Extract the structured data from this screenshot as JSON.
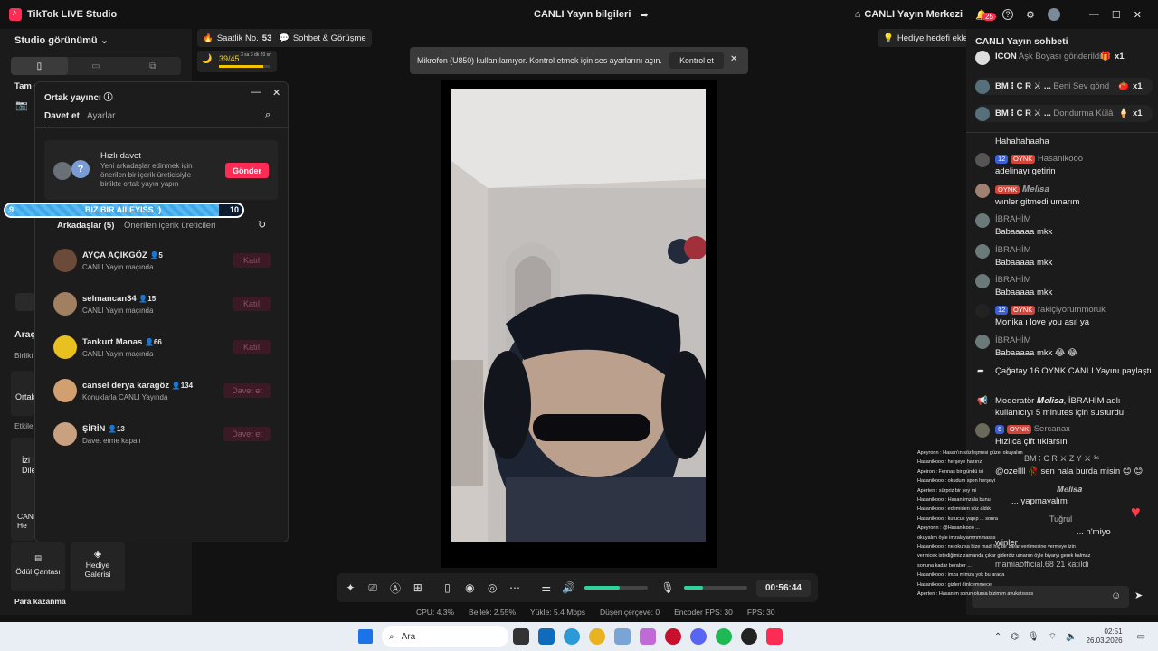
{
  "window": {
    "app_title": "TikTok LIVE Studio",
    "center_title": "CANLI Yayın bilgileri",
    "live_center": "CANLI Yayın Merkezi",
    "notif_count": "25"
  },
  "left": {
    "studio_view": "Studio görünümü",
    "tam_ekran": "Tam e",
    "araclar": "Araç",
    "birlikte": "Birlikt",
    "ortak": "Ortak",
    "etkile": "Etkile",
    "izin": "İzi",
    "dile": "Dile",
    "canli": "CANL",
    "he": "He",
    "odul": "Ödül Çantası",
    "hediye": "Hediye Galerisi",
    "para": "Para kazanma"
  },
  "stats": {
    "rank_label": "Saatlik No.",
    "rank_value": "53",
    "sohbet": "Sohbet & Görüşme",
    "progress": "39/45",
    "progress_fraction": 0.87,
    "progress_time": "3 sa 3 dk 20 sn",
    "gift_goal": "Hediye hedefi ekle"
  },
  "cohost": {
    "title": "Ortak yayıncı",
    "tab_invite": "Davet et",
    "tab_settings": "Ayarlar",
    "quick_title": "Hızlı davet",
    "quick_desc": "Yeni arkadaşlar edinmek için önerilen bir içerik üreticisiyle birlikte ortak yayın yapın",
    "send": "Gönder",
    "friends_tab": "Arkadaşlar (5)",
    "suggested_tab": "Önerilen içerik üreticileri",
    "users": [
      {
        "name": "AYÇA AÇIKGÖZ",
        "count": "5",
        "status": "CANLI Yayın maçında",
        "btn": "Katıl",
        "color": "#6b4a3a"
      },
      {
        "name": "selmancan34",
        "count": "15",
        "status": "CANLI Yayın maçında",
        "btn": "Katıl",
        "color": "#a08060"
      },
      {
        "name": "Tankurt Manas",
        "count": "66",
        "status": "CANLI Yayın maçında",
        "btn": "Katıl",
        "color": "#e8c020"
      },
      {
        "name": "cansel derya karagöz",
        "count": "134",
        "status": "Konuklarla CANLI Yayında",
        "btn": "Davet et",
        "color": "#d2a070"
      },
      {
        "name": "ŞİRİN",
        "count": "13",
        "status": "Davet etme kapalı",
        "btn": "Davet et",
        "color": "#c9a080"
      }
    ]
  },
  "banner": {
    "left": "9",
    "text": "BIZ BIR AILEYISS :)",
    "right": "10",
    "fraction": 0.9
  },
  "toast": {
    "text": "Mikrofon (U850) kullanılamıyor. Kontrol etmek için ses ayarlarını açın.",
    "button": "Kontrol et"
  },
  "controls": {
    "timer": "00:56:44",
    "volume_fraction": 0.55,
    "mic_fraction": 0.3
  },
  "status": {
    "cpu": "CPU: 4.3%",
    "mem": "Bellek: 2.55%",
    "upload": "Yükle: 5.4 Mbps",
    "drop": "Düşen çerçeve: 0",
    "encoder": "Encoder FPS: 30",
    "fps": "FPS: 30"
  },
  "chat": {
    "title": "CANLI Yayın sohbeti",
    "gifts": [
      {
        "user": "ICON",
        "text": "Aşk Boyası gönderildi",
        "count": "x1"
      },
      {
        "user": "BM ⁝ C R ⚔︎ ...",
        "text": "Beni Sev gönd",
        "count": "x1"
      },
      {
        "user": "BM ⁝ C R ⚔︎ ...",
        "text": "Dondurma Külâ",
        "count": "x1"
      }
    ],
    "first": "Hahahahaaha",
    "messages": [
      {
        "lvl": "12",
        "fan": "OYNK",
        "user": "Hasanikooo",
        "text": "adelinayı getirin"
      },
      {
        "lvl": "",
        "fan": "OYNK",
        "user": "𝑴𝒆𝒍𝒊𝒔𝒂",
        "text": "wınler gitmedi umarım"
      },
      {
        "lvl": "",
        "fan": "",
        "user": "İBRAHİM",
        "text": "Babaaaaa mkk"
      },
      {
        "lvl": "",
        "fan": "",
        "user": "İBRAHİM",
        "text": "Babaaaaa mkk"
      },
      {
        "lvl": "",
        "fan": "",
        "user": "İBRAHİM",
        "text": "Babaaaaa mkk"
      },
      {
        "lvl": "12",
        "fan": "OYNK",
        "user": "rakiçiyorummoruk",
        "text": "Monika ı love you asıl ya"
      },
      {
        "lvl": "",
        "fan": "",
        "user": "İBRAHİM",
        "text": "Babaaaaa mkk 😂 😂"
      }
    ],
    "share": "Çağatay 16 OYNK CANLI Yayını paylaştı",
    "mod": "Moderatör 𝑴𝒆𝒍𝒊𝒔𝒂, İBRAHİM adlı kullanıcıyı 5 minutes için susturdu",
    "sercan": {
      "lvl": "6",
      "fan": "OYNK",
      "user": "Sercanax",
      "text": "Hızlıca çift tıklarsın"
    },
    "bottom": [
      "BM ⁝ C R ⚔︎ Z Y ⚔︎ ³⁶",
      "@ozellll 🥀 sen hala burda misin 😊 😊",
      "𝑴𝒆𝒍𝒊𝒔𝒂",
      "... yapmayalım",
      "Tuğrul",
      "... n'miyo",
      "winler",
      "mamiaofficial.68 21 katıldı"
    ]
  },
  "ticker": [
    "Apeyronn : Hasan'ın sözleşmesi güzel okuyalım",
    "Hasanikooo : herşeye hazırız",
    "Apeiron : Fennas bir gündü isi",
    "Hasanikooo : okudum spon herşeyi",
    "Aperten : sürpriz bir şey mi",
    "Hasanikooo : Hasan imzala bunu",
    "Hasanikooo : edemiden söz aldık",
    "Hasanikooo : kutucuk yapıp ... sonra",
    "Apeyronn : @Hasanikooo ...",
    "okuyalım öyle imzalayammmmasss",
    "Hasanikooo : ne okursa bize madi hiç bir zarar verilmesine vermeye izin",
    "vermicek istediğimiz zamanda çıkar giderdiz umarım öyle biyaryı gerek kalmaz",
    "sonuna kadar beraber ...",
    "Hasanikooo : imza mimza yok bu arada",
    "Hasanikooo : gizleri dinlcemmece",
    "Aperten : Hasanım sorun olursa bizimim avukatıssss"
  ],
  "taskbar": {
    "search": "Ara",
    "time": "02:51",
    "date": "26.03.2026"
  }
}
